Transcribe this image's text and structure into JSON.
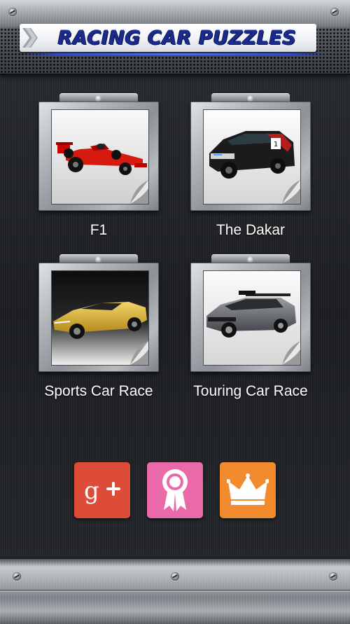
{
  "header": {
    "title": "RACING CAR PUZZLES"
  },
  "puzzles": [
    {
      "label": "F1",
      "image_icon": "red-formula-one-car-image"
    },
    {
      "label": "The Dakar",
      "image_icon": "black-rally-suv-image"
    },
    {
      "label": "Sports Car Race",
      "image_icon": "yellow-lamborghini-image"
    },
    {
      "label": "Touring Car Race",
      "image_icon": "grey-saab-touring-car-image"
    }
  ],
  "actions": [
    {
      "name": "google-plus",
      "icon": "google-plus-icon",
      "color": "#dd4b39"
    },
    {
      "name": "achievements",
      "icon": "ribbon-award-icon",
      "color": "#ea6aa9"
    },
    {
      "name": "leaderboard",
      "icon": "crown-icon",
      "color": "#f28a2e"
    }
  ],
  "colors": {
    "title_text": "#1c2a8c",
    "background": "#1f2225",
    "label_text": "#ffffff"
  }
}
